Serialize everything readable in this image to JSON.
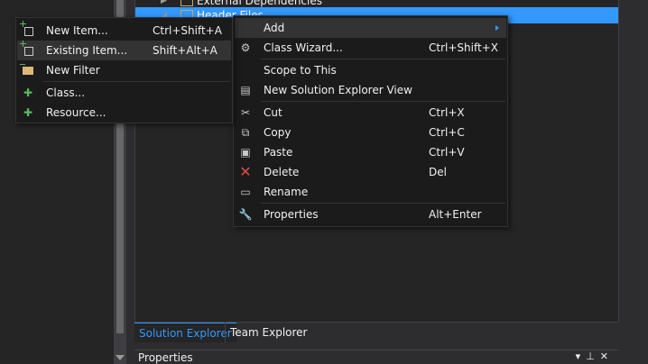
{
  "tree": {
    "external_label": "External Dependencies",
    "header_label": "Header Files"
  },
  "tabs": {
    "solution_explorer": "Solution Explorer",
    "team_explorer": "Team Explorer"
  },
  "properties": {
    "title": "Properties"
  },
  "context_menu": {
    "items": [
      {
        "label": "Add",
        "shortcut": "",
        "icon": "none"
      },
      {
        "label": "Class Wizard...",
        "shortcut": "Ctrl+Shift+X",
        "icon": "class-wizard-icon"
      },
      {
        "label": "Scope to This",
        "shortcut": "",
        "icon": "none"
      },
      {
        "label": "New Solution Explorer View",
        "shortcut": "",
        "icon": "new-view-icon"
      },
      {
        "label": "Cut",
        "shortcut": "Ctrl+X",
        "icon": "cut-icon"
      },
      {
        "label": "Copy",
        "shortcut": "Ctrl+C",
        "icon": "copy-icon"
      },
      {
        "label": "Paste",
        "shortcut": "Ctrl+V",
        "icon": "paste-icon"
      },
      {
        "label": "Delete",
        "shortcut": "Del",
        "icon": "delete-icon"
      },
      {
        "label": "Rename",
        "shortcut": "",
        "icon": "rename-icon"
      },
      {
        "label": "Properties",
        "shortcut": "Alt+Enter",
        "icon": "wrench-icon"
      }
    ]
  },
  "add_submenu": {
    "items": [
      {
        "label": "New Item...",
        "shortcut": "Ctrl+Shift+A",
        "icon": "new-item-icon"
      },
      {
        "label": "Existing Item...",
        "shortcut": "Shift+Alt+A",
        "icon": "existing-item-icon"
      },
      {
        "label": "New Filter",
        "shortcut": "",
        "icon": "new-filter-icon"
      },
      {
        "label": "Class...",
        "shortcut": "",
        "icon": "class-icon"
      },
      {
        "label": "Resource...",
        "shortcut": "",
        "icon": "resource-icon"
      }
    ]
  },
  "colors": {
    "accent": "#3399ff",
    "menu_bg": "#1b1b1c",
    "highlight": "#333334",
    "delete_icon": "#e04848"
  }
}
